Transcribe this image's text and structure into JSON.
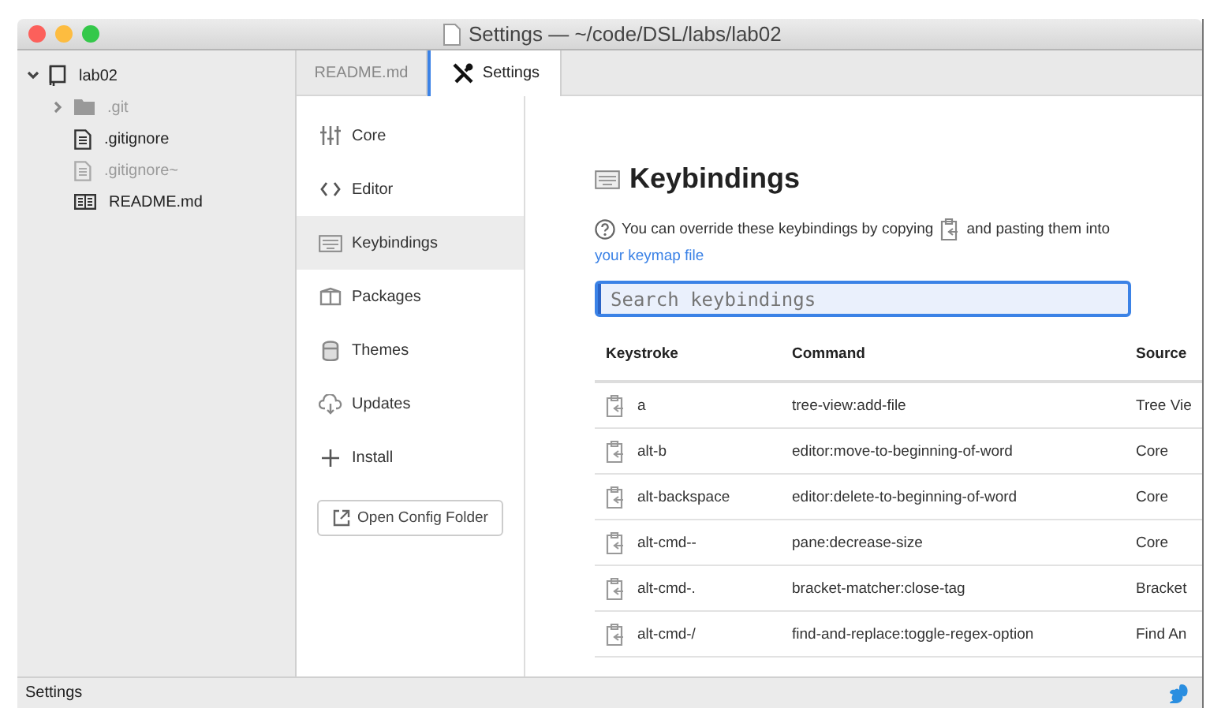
{
  "window": {
    "title": "Settings — ~/code/DSL/labs/lab02"
  },
  "tree": [
    {
      "name": "lab02",
      "kind": "repo",
      "expanded": true,
      "dimmed": false,
      "children": [
        {
          "name": ".git",
          "kind": "folder",
          "expanded": false,
          "dimmed": true
        },
        {
          "name": ".gitignore",
          "kind": "file",
          "dimmed": false
        },
        {
          "name": ".gitignore~",
          "kind": "file",
          "dimmed": true
        },
        {
          "name": "README.md",
          "kind": "book",
          "dimmed": false
        }
      ]
    }
  ],
  "tabs": [
    {
      "label": "README.md",
      "selected": false,
      "kind": "file"
    },
    {
      "label": "Settings",
      "selected": true,
      "kind": "settings"
    }
  ],
  "settings_menu": [
    {
      "label": "Core",
      "selected": false
    },
    {
      "label": "Editor",
      "selected": false
    },
    {
      "label": "Keybindings",
      "selected": true
    },
    {
      "label": "Packages",
      "selected": false
    },
    {
      "label": "Themes",
      "selected": false
    },
    {
      "label": "Updates",
      "selected": false
    },
    {
      "label": "Install",
      "selected": false
    }
  ],
  "open_config_button": "Open Config Folder",
  "heading": "Keybindings",
  "info": {
    "before": "You can override these keybindings by copying",
    "after": "and pasting them into",
    "link": "your keymap file"
  },
  "search": {
    "placeholder": "Search keybindings"
  },
  "table": {
    "columns": [
      "Keystroke",
      "Command",
      "Source"
    ],
    "rows": [
      [
        "a",
        "tree-view:add-file",
        "Tree Vie"
      ],
      [
        "alt-b",
        "editor:move-to-beginning-of-word",
        "Core"
      ],
      [
        "alt-backspace",
        "editor:delete-to-beginning-of-word",
        "Core"
      ],
      [
        "alt-cmd--",
        "pane:decrease-size",
        "Core"
      ],
      [
        "alt-cmd-.",
        "bracket-matcher:close-tag",
        "Bracket"
      ],
      [
        "alt-cmd-/",
        "find-and-replace:toggle-regex-option",
        "Find An"
      ]
    ]
  },
  "status_bar": {
    "text": "Settings"
  }
}
